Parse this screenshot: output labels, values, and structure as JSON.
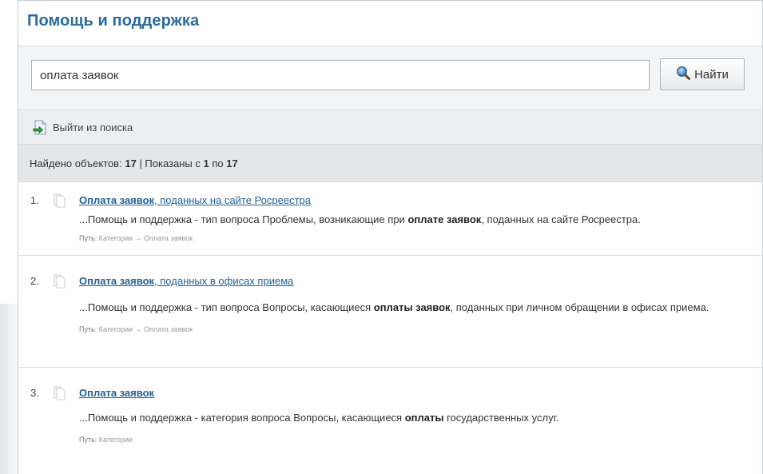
{
  "header": {
    "title": "Помощь и поддержка"
  },
  "search": {
    "value": "оплата заявок",
    "button_label": "Найти"
  },
  "exit_bar": {
    "label": "Выйти из поиска"
  },
  "summary": {
    "found_label": "Найдено объектов:",
    "found_count": "17",
    "shown_label": "| Показаны с",
    "from": "1",
    "to_label": "по",
    "to": "17"
  },
  "results": [
    {
      "number": "1.",
      "title_bold": "Оплата заявок",
      "title_rest": ", поданных на сайте Росреестра",
      "snippet_pre": "...Помощь и поддержка - тип вопроса Проблемы, возникающие при ",
      "snippet_bold": "оплате заявок",
      "snippet_post": ", поданных на сайте Росреестра.",
      "path_label": "Путь:",
      "path_value": "Категории → Оплата заявок"
    },
    {
      "number": "2.",
      "title_bold": "Оплата заявок",
      "title_rest": ", поданных в офисах приема",
      "snippet_pre": "...Помощь и поддержка - тип вопроса Вопросы, касающиеся ",
      "snippet_bold": "оплаты заявок",
      "snippet_post": ", поданных при личном обращении в офисах приема.",
      "path_label": "Путь:",
      "path_value": "Категории → Оплата заявок"
    },
    {
      "number": "3.",
      "title_bold": "Оплата заявок",
      "title_rest": "",
      "snippet_pre": "...Помощь и поддержка - категория вопроса Вопросы, касающиеся ",
      "snippet_bold": "оплаты",
      "snippet_post": " государственных услуг.",
      "path_label": "Путь:",
      "path_value": "Категории"
    }
  ]
}
